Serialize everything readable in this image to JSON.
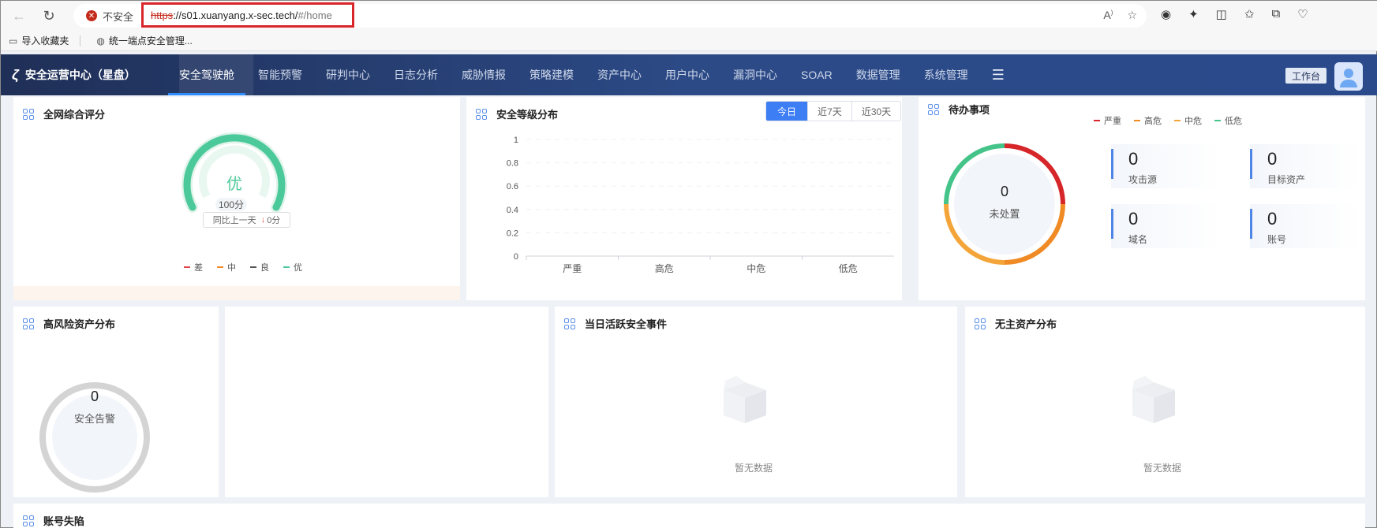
{
  "browser": {
    "insecure_label": "不安全",
    "url_proto": "https",
    "url_host": "://s01.xuanyang.x-sec.tech/",
    "url_path": "#/home",
    "bookmarks": [
      "导入收藏夹",
      "统一端点安全管理..."
    ]
  },
  "header": {
    "title": "安全运营中心（星盘）",
    "menu": [
      "安全驾驶舱",
      "智能预警",
      "研判中心",
      "日志分析",
      "威胁情报",
      "策略建模",
      "资产中心",
      "用户中心",
      "漏洞中心",
      "SOAR",
      "数据管理",
      "系统管理"
    ],
    "workbench_label": "工作台"
  },
  "score_panel": {
    "title": "全网综合评分",
    "grade": "优",
    "score": "100分",
    "compare_label": "同比上一天",
    "compare_arrow": "↓",
    "compare_value": "0分",
    "legend": [
      {
        "label": "差",
        "color": "#e0474c"
      },
      {
        "label": "中",
        "color": "#f08a24"
      },
      {
        "label": "良",
        "color": "#555555"
      },
      {
        "label": "优",
        "color": "#4cc99a"
      }
    ],
    "gauge_fraction": 1.0
  },
  "level_panel": {
    "title": "安全等级分布",
    "tabs": [
      "今日",
      "近7天",
      "近30天"
    ],
    "active_tab": "今日"
  },
  "chart_data": {
    "type": "bar",
    "categories": [
      "严重",
      "高危",
      "中危",
      "低危"
    ],
    "values": [
      0,
      0,
      0,
      0
    ],
    "ylim": [
      0,
      1
    ],
    "yticks": [
      "1",
      "0.8",
      "0.6",
      "0.4",
      "0.2",
      "0"
    ],
    "title": "",
    "xlabel": "",
    "ylabel": "",
    "grid": true
  },
  "todo_panel": {
    "title": "待办事项",
    "legend": [
      {
        "label": "严重",
        "color": "#d6262a"
      },
      {
        "label": "高危",
        "color": "#f08a24"
      },
      {
        "label": "中危",
        "color": "#f4a53a"
      },
      {
        "label": "低危",
        "color": "#45c48a"
      }
    ],
    "ring_value": "0",
    "ring_label": "未处置",
    "stats": [
      {
        "value": "0",
        "label": "攻击源"
      },
      {
        "value": "0",
        "label": "目标资产"
      },
      {
        "value": "0",
        "label": "域名"
      },
      {
        "value": "0",
        "label": "账号"
      }
    ]
  },
  "risk_panel": {
    "title": "高风险资产分布",
    "ring_value": "0",
    "ring_label": "安全告警"
  },
  "events_panel": {
    "title": "当日活跃安全事件",
    "empty_text": "暂无数据"
  },
  "unowned_panel": {
    "title": "无主资产分布",
    "empty_text": "暂无数据"
  },
  "account_panel": {
    "title": "账号失陷"
  }
}
